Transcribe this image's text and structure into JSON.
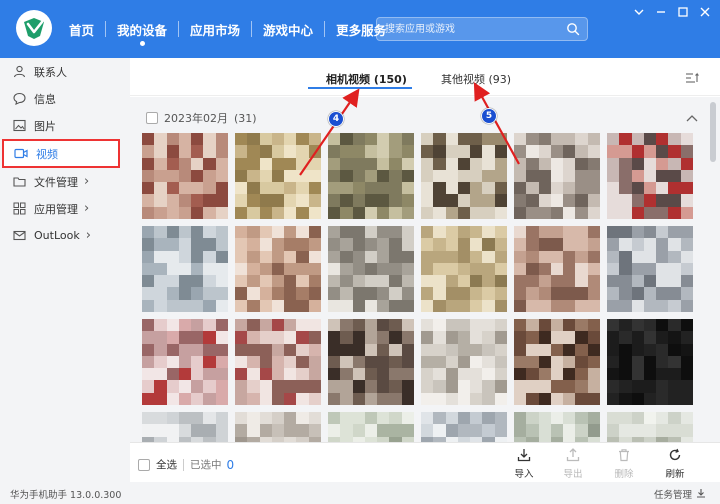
{
  "nav": {
    "items": [
      {
        "label": "首页"
      },
      {
        "label": "我的设备"
      },
      {
        "label": "应用市场"
      },
      {
        "label": "游戏中心"
      },
      {
        "label": "更多服务"
      }
    ],
    "active": "我的设备"
  },
  "search": {
    "placeholder": "搜索应用或游戏",
    "icon": "search-icon"
  },
  "window_controls": [
    "menu-icon",
    "minimize-icon",
    "maximize-icon",
    "close-icon"
  ],
  "sidebar": {
    "items": [
      {
        "label": "联系人",
        "icon": "person-icon"
      },
      {
        "label": "信息",
        "icon": "message-icon"
      },
      {
        "label": "图片",
        "icon": "image-icon"
      },
      {
        "label": "视频",
        "icon": "video-icon",
        "active": true
      },
      {
        "label": "文件管理",
        "icon": "folder-icon",
        "chevron": "›"
      },
      {
        "label": "应用管理",
        "icon": "apps-icon",
        "chevron": "›"
      },
      {
        "label": "OutLook",
        "icon": "mail-icon",
        "chevron": "›"
      }
    ]
  },
  "tabs": [
    {
      "label": "相机视频 (150)",
      "active": true
    },
    {
      "label": "其他视频 (93)",
      "active": false
    }
  ],
  "group": {
    "title": "2023年02月",
    "count": "(31)"
  },
  "bottom": {
    "select_all": "全选",
    "selected_label": "已选中",
    "selected_count": "0",
    "actions": [
      {
        "label": "导入",
        "icon": "import-icon",
        "enabled": true
      },
      {
        "label": "导出",
        "icon": "export-icon",
        "enabled": false
      },
      {
        "label": "删除",
        "icon": "delete-icon",
        "enabled": false
      },
      {
        "label": "刷新",
        "icon": "refresh-icon",
        "enabled": true
      }
    ]
  },
  "status": {
    "version": "华为手机助手 13.0.0.300",
    "task_manager": "任务管理"
  },
  "annotations": [
    {
      "label": "4"
    },
    {
      "label": "5"
    }
  ],
  "colors": {
    "accent": "#2f7de6",
    "highlight_box": "#e33333",
    "arrow": "#e02020",
    "badge": "#1a4fd1"
  }
}
